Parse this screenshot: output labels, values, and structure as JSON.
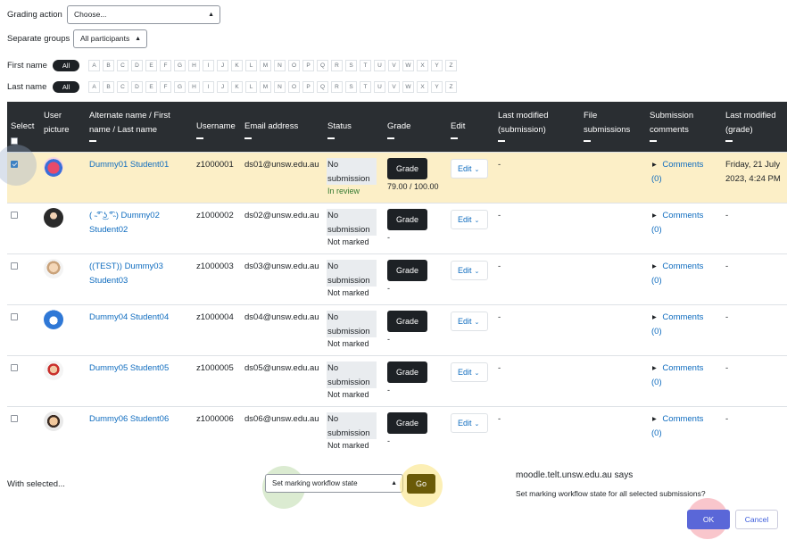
{
  "filters": {
    "grading_action_label": "Grading action",
    "grading_action_value": "Choose...",
    "groups_label": "Separate groups",
    "groups_value": "All participants",
    "first_name_label": "First name",
    "last_name_label": "Last name",
    "all_label": "All",
    "letters": [
      "A",
      "B",
      "C",
      "D",
      "E",
      "F",
      "G",
      "H",
      "I",
      "J",
      "K",
      "L",
      "M",
      "N",
      "O",
      "P",
      "Q",
      "R",
      "S",
      "T",
      "U",
      "V",
      "W",
      "X",
      "Y",
      "Z"
    ]
  },
  "table": {
    "headers": {
      "select": "Select",
      "picture": "User picture",
      "name": "Alternate name / First name / Last name",
      "username": "Username",
      "email": "Email address",
      "status": "Status",
      "grade": "Grade",
      "edit": "Edit",
      "last_modified_submission": "Last modified (submission)",
      "file_submissions": "File submissions",
      "submission_comments": "Submission comments",
      "last_modified_grade": "Last modified (grade)"
    },
    "grade_button_label": "Grade",
    "edit_button_label": "Edit",
    "comments_label": "Comments",
    "rows": [
      {
        "name": "Dummy01 Student01",
        "username": "z1000001",
        "email": "ds01@unsw.edu.au",
        "status": "No submission",
        "substatus": "In review",
        "grade_value": "79.00 / 100.00",
        "last_modified_submission": "-",
        "comments_count": "(0)",
        "last_modified_grade": "Friday, 21 July 2023, 4:24 PM",
        "checked": true
      },
      {
        "name": "( ˵͡° ͜ʖ ͡°˵) Dummy02 Student02",
        "username": "z1000002",
        "email": "ds02@unsw.edu.au",
        "status": "No submission",
        "substatus": "Not marked",
        "grade_value": "-",
        "last_modified_submission": "-",
        "comments_count": "(0)",
        "last_modified_grade": "-",
        "checked": false
      },
      {
        "name": "((TEST)) Dummy03 Student03",
        "username": "z1000003",
        "email": "ds03@unsw.edu.au",
        "status": "No submission",
        "substatus": "Not marked",
        "grade_value": "-",
        "last_modified_submission": "-",
        "comments_count": "(0)",
        "last_modified_grade": "-",
        "checked": false
      },
      {
        "name": "Dummy04 Student04",
        "username": "z1000004",
        "email": "ds04@unsw.edu.au",
        "status": "No submission",
        "substatus": "Not marked",
        "grade_value": "-",
        "last_modified_submission": "-",
        "comments_count": "(0)",
        "last_modified_grade": "-",
        "checked": false
      },
      {
        "name": "Dummy05 Student05",
        "username": "z1000005",
        "email": "ds05@unsw.edu.au",
        "status": "No submission",
        "substatus": "Not marked",
        "grade_value": "-",
        "last_modified_submission": "-",
        "comments_count": "(0)",
        "last_modified_grade": "-",
        "checked": false
      },
      {
        "name": "Dummy06 Student06",
        "username": "z1000006",
        "email": "ds06@unsw.edu.au",
        "status": "No submission",
        "substatus": "Not marked",
        "grade_value": "-",
        "last_modified_submission": "-",
        "comments_count": "(0)",
        "last_modified_grade": "-",
        "checked": false
      }
    ]
  },
  "bulk": {
    "with_selected_label": "With selected...",
    "action_value": "Set marking workflow state",
    "go_label": "Go"
  },
  "dialog": {
    "title": "moodle.telt.unsw.edu.au says",
    "message": "Set marking workflow state for all selected submissions?",
    "ok_label": "OK",
    "cancel_label": "Cancel"
  },
  "colors": {
    "header_bg": "#2a2e32",
    "selected_row_bg": "#fcefc7",
    "link": "#0f6cbf",
    "go_button": "#6a5a08",
    "ok_button": "#5a67d8"
  }
}
